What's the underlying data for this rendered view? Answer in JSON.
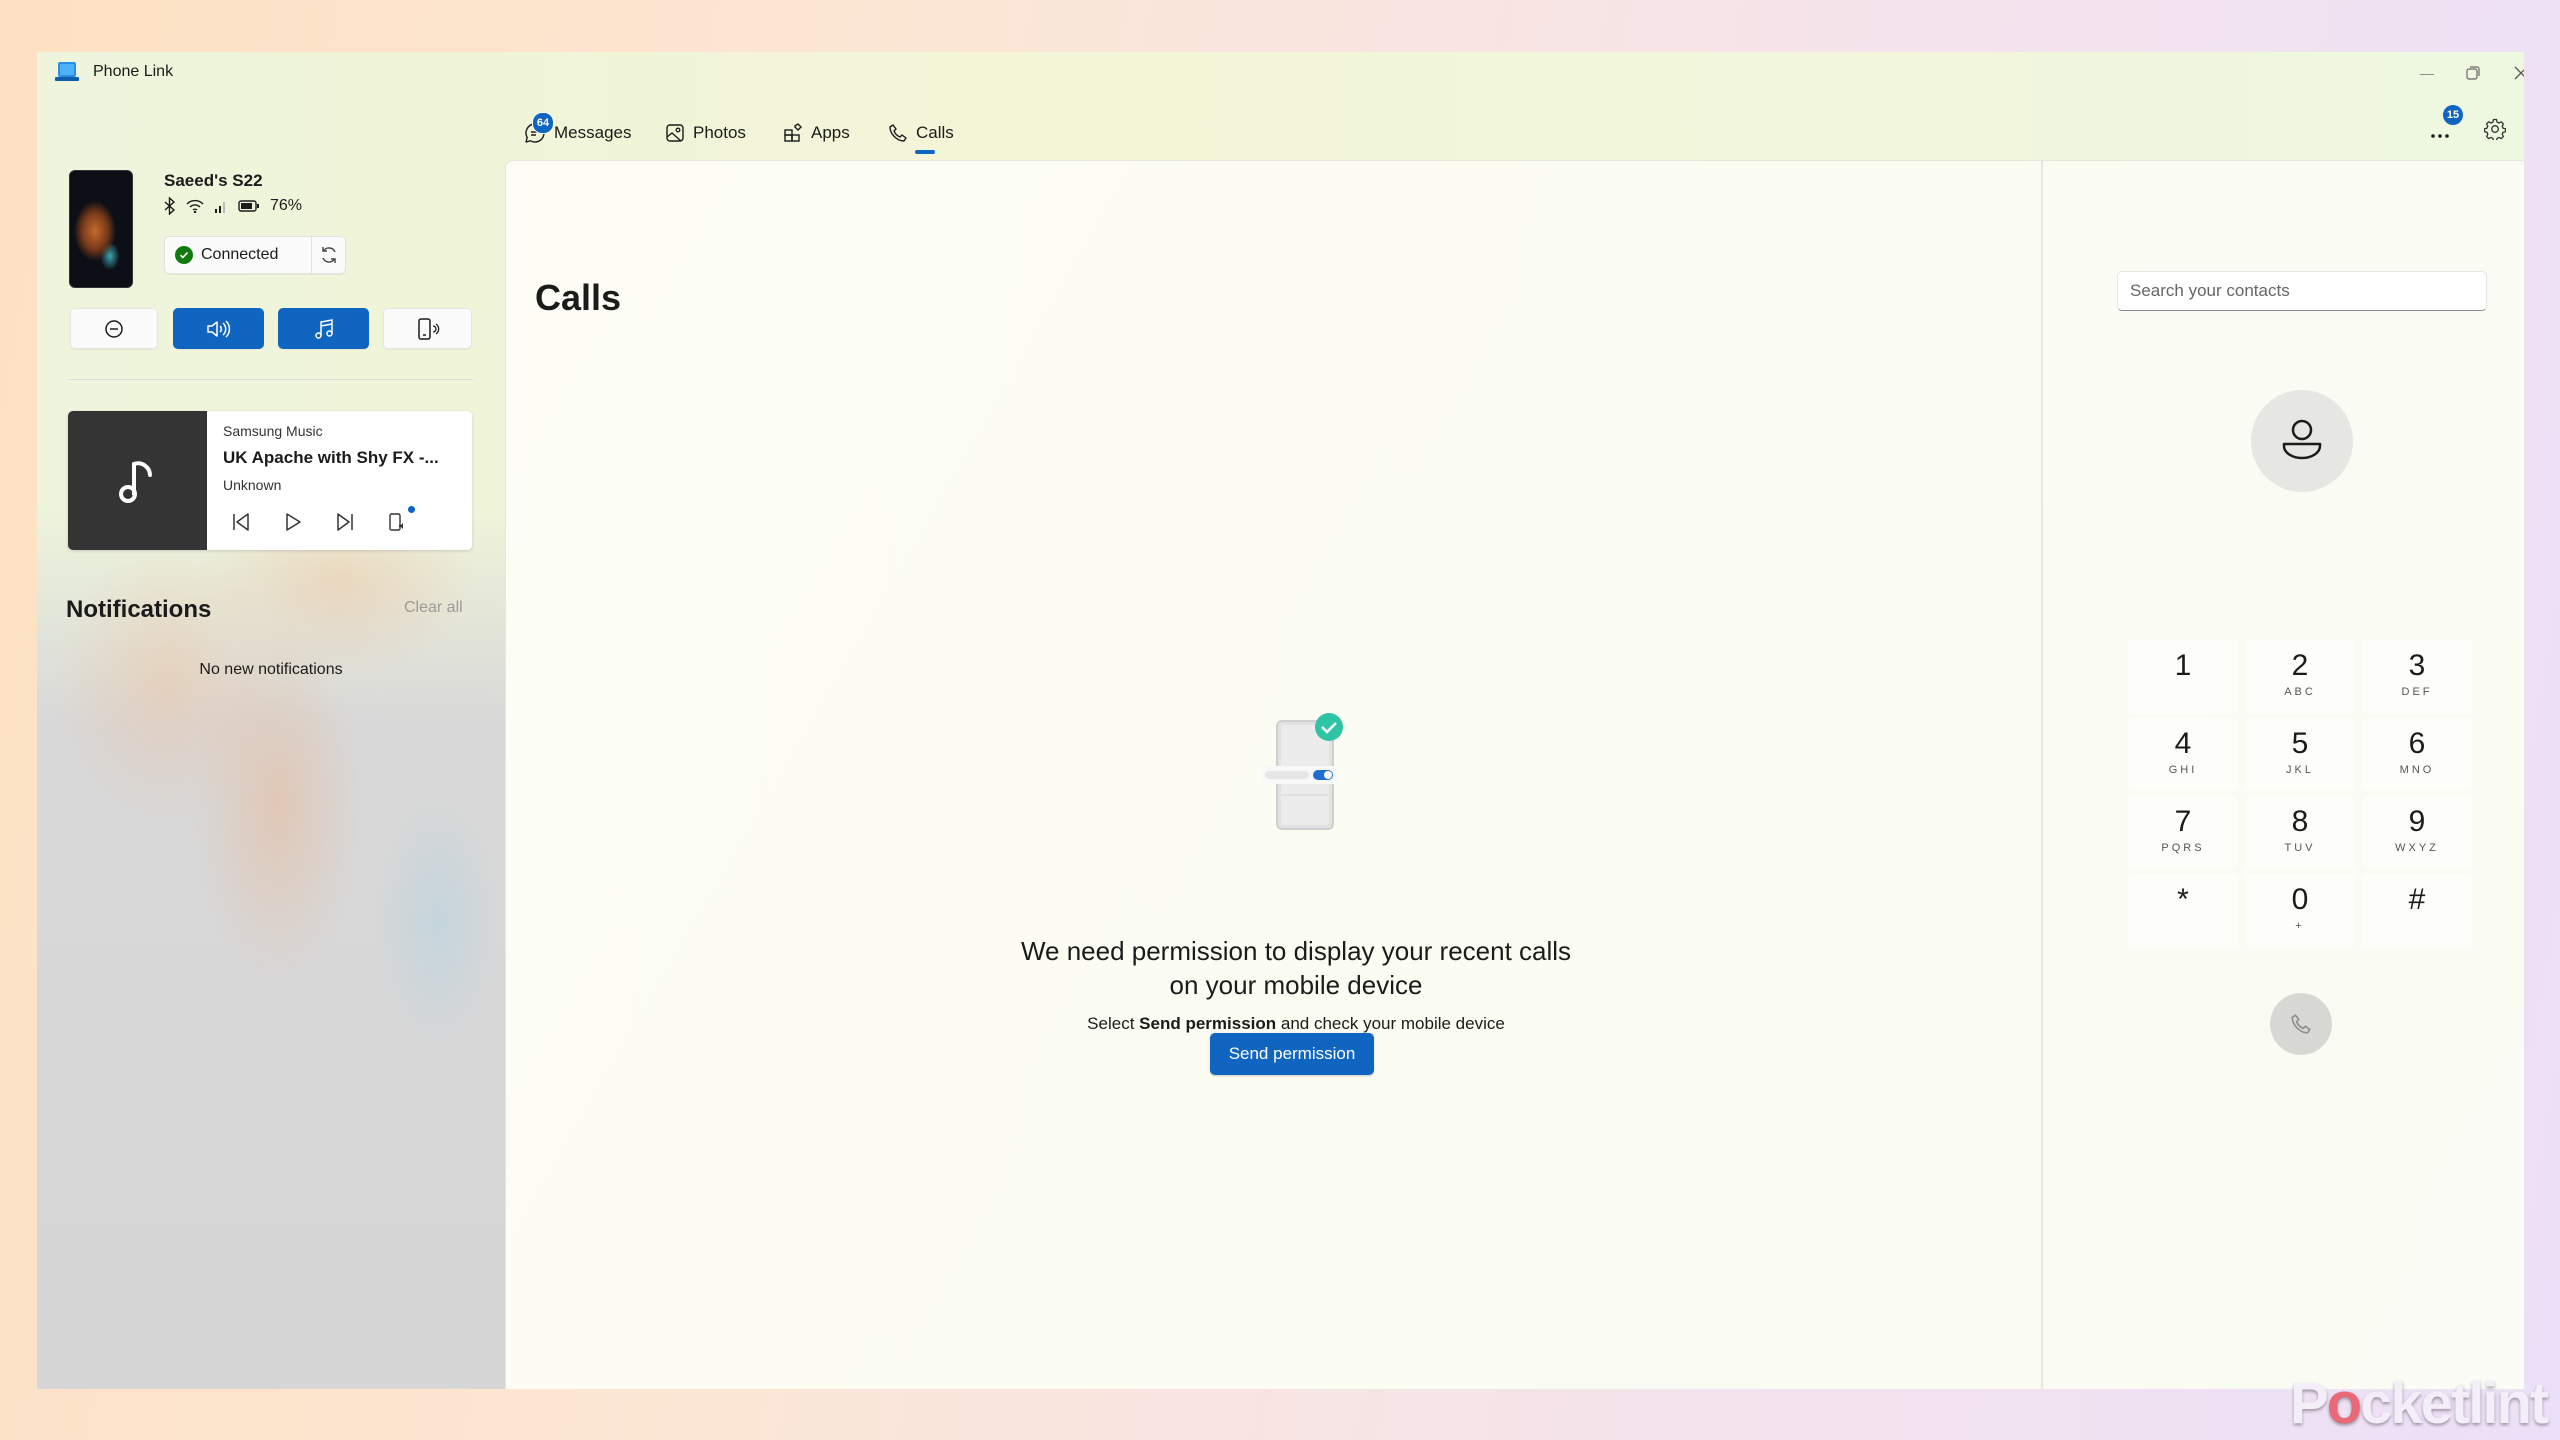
{
  "window": {
    "title": "Phone Link",
    "controls": {
      "minimize": "—",
      "restore": "❐",
      "close": "✕"
    }
  },
  "device": {
    "name": "Saeed's S22",
    "battery": "76%",
    "status_icons": [
      "bluetooth-icon",
      "wifi-icon",
      "signal-icon",
      "battery-icon"
    ],
    "connection": {
      "label": "Connected",
      "state_color": "#0f7b0f"
    }
  },
  "quick_actions": [
    {
      "name": "do-not-disturb",
      "active": false
    },
    {
      "name": "audio",
      "active": true
    },
    {
      "name": "media",
      "active": true
    },
    {
      "name": "ring-phone",
      "active": false
    }
  ],
  "media": {
    "source": "Samsung Music",
    "title": "UK Apache with Shy FX -...",
    "artist": "Unknown"
  },
  "notifications": {
    "heading": "Notifications",
    "clear_all": "Clear all",
    "empty": "No new notifications"
  },
  "tabs": [
    {
      "label": "Messages",
      "badge": "64",
      "selected": false
    },
    {
      "label": "Photos",
      "selected": false
    },
    {
      "label": "Apps",
      "selected": false
    },
    {
      "label": "Calls",
      "selected": true
    }
  ],
  "topbar": {
    "more_badge": "15"
  },
  "calls": {
    "title": "Calls",
    "permission_heading": "We need permission to display your recent calls on your mobile device",
    "permission_sub_prefix": "Select ",
    "permission_sub_bold": "Send permission",
    "permission_sub_suffix": " and check your mobile device",
    "send_button": "Send permission"
  },
  "dialer": {
    "search_placeholder": "Search your contacts",
    "keys": [
      {
        "digit": "1",
        "letters": ""
      },
      {
        "digit": "2",
        "letters": "ABC"
      },
      {
        "digit": "3",
        "letters": "DEF"
      },
      {
        "digit": "4",
        "letters": "GHI"
      },
      {
        "digit": "5",
        "letters": "JKL"
      },
      {
        "digit": "6",
        "letters": "MNO"
      },
      {
        "digit": "7",
        "letters": "PQRS"
      },
      {
        "digit": "8",
        "letters": "TUV"
      },
      {
        "digit": "9",
        "letters": "WXYZ"
      },
      {
        "digit": "*",
        "letters": ""
      },
      {
        "digit": "0",
        "letters": "+"
      },
      {
        "digit": "#",
        "letters": ""
      }
    ]
  },
  "colors": {
    "accent": "#0f65c0",
    "success": "#0f7b0f",
    "badge": "#0f65c0"
  },
  "watermark": {
    "pre": "P",
    "o": "o",
    "post": "cketlint"
  }
}
